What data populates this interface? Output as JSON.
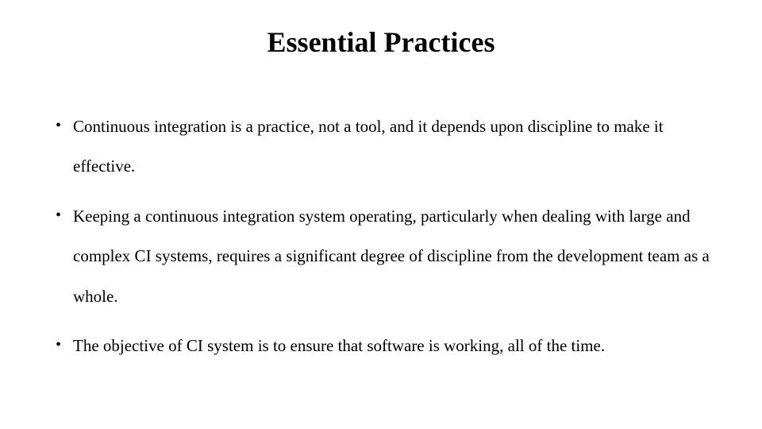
{
  "slide": {
    "title": "Essential Practices",
    "bullets": [
      "Continuous integration is a practice, not a tool, and it depends upon discipline to make it effective.",
      "Keeping a continuous integration system operating, particularly when dealing with large and complex CI systems, requires a significant degree of discipline from the development team as a whole.",
      "The objective of CI system is to ensure that software is working, all of the time."
    ]
  }
}
